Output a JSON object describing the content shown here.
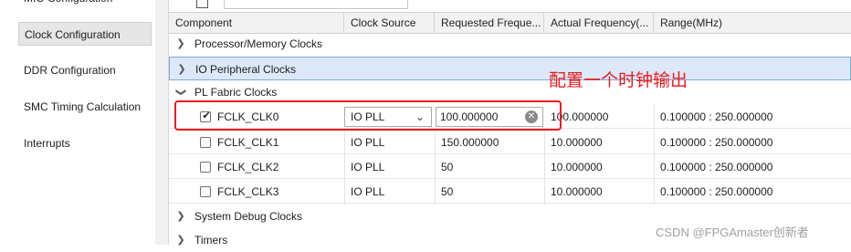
{
  "sidebar": {
    "items": [
      {
        "label": "MIO Configuration"
      },
      {
        "label": "Clock Configuration"
      },
      {
        "label": "DDR Configuration"
      },
      {
        "label": "SMC Timing Calculation"
      },
      {
        "label": "Interrupts"
      }
    ],
    "selected_index": 1
  },
  "table": {
    "headers": {
      "component": "Component",
      "clock_source": "Clock Source",
      "requested": "Requested Freque...",
      "actual": "Actual Frequency(...",
      "range": "Range(MHz)"
    },
    "groups": {
      "processor": "Processor/Memory Clocks",
      "io": "IO Peripheral Clocks",
      "pl": "PL Fabric Clocks",
      "debug": "System Debug Clocks",
      "timers": "Timers"
    },
    "clocks": [
      {
        "name": "FCLK_CLK0",
        "checked": true,
        "source": "IO PLL",
        "requested": "100.000000",
        "actual": "100.000000",
        "range": "0.100000 : 250.000000"
      },
      {
        "name": "FCLK_CLK1",
        "checked": false,
        "source": "IO PLL",
        "requested": "150.000000",
        "actual": "10.000000",
        "range": "0.100000 : 250.000000"
      },
      {
        "name": "FCLK_CLK2",
        "checked": false,
        "source": "IO PLL",
        "requested": "50",
        "actual": "10.000000",
        "range": "0.100000 : 250.000000"
      },
      {
        "name": "FCLK_CLK3",
        "checked": false,
        "source": "IO PLL",
        "requested": "50",
        "actual": "10.000000",
        "range": "0.100000 : 250.000000"
      }
    ]
  },
  "annotation": {
    "text": "配置一个时钟输出",
    "color": "#ee1c1c"
  },
  "watermark": "CSDN @FPGAmaster创新者",
  "colors": {
    "selected_group_bg": "#dde9f8",
    "selected_group_border": "#7fa8d8",
    "annotation": "#ee1c1c"
  }
}
